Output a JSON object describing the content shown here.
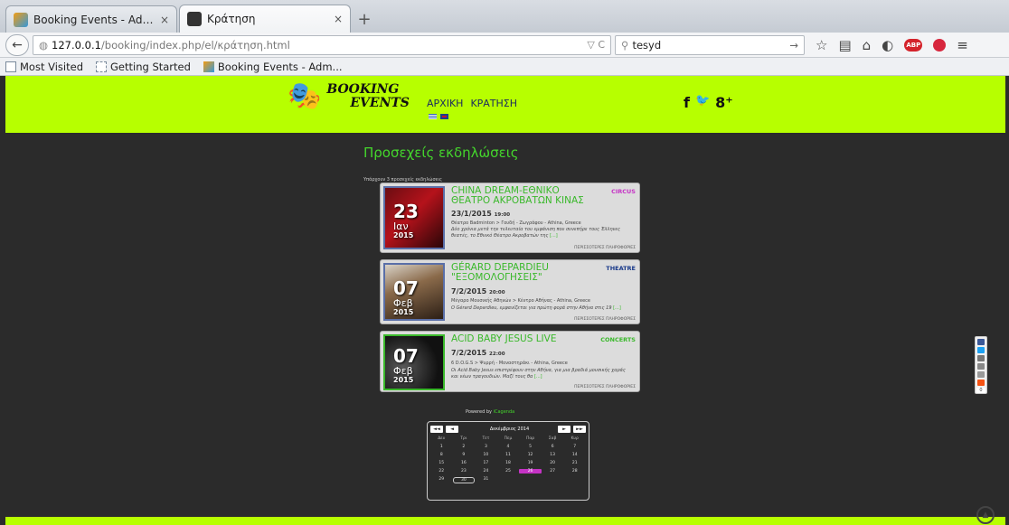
{
  "browser": {
    "tabs": [
      {
        "title": "Booking Events - Administ...",
        "close": "×",
        "active": false
      },
      {
        "title": "Κράτηση",
        "close": "×",
        "active": true
      }
    ],
    "new_tab": "+",
    "url_host": "127.0.0.1",
    "url_path": "/booking/index.php/el/κράτηση.html",
    "url_right": "▽ C",
    "search_value": "tesyd",
    "bookmarks": [
      "Most Visited",
      "Getting Started",
      "Booking Events - Adm..."
    ]
  },
  "site": {
    "logo": {
      "line1": "BOOKING",
      "line2": "EVENTS"
    },
    "menu": [
      "ΑΡΧΙΚΗ",
      "ΚΡΑΤΗΣΗ"
    ],
    "social": [
      "f",
      "🐦",
      "8⁺"
    ],
    "heading": "Προσεχείς εκδηλώσεις",
    "subheading": "Υπάρχουν 3 προσεχείς εκδηλώσεις",
    "events": [
      {
        "title": "CHINA DREAM-ΕΘΝΙΚΟ ΘΕΑΤΡΟ ΑΚΡΟΒΑΤΩΝ ΚΙΝΑΣ",
        "category": "CIRCUS",
        "category_color": "#c533c5",
        "day": "23",
        "month": "Ιαν",
        "year": "2015",
        "date": "23/1/2015",
        "time": "19:00",
        "venue": "Θέατρο Badminton > Γουδή - Ζωγράφου - Athina, Greece",
        "desc": "Δύο χρόνια μετά την τελευταία του εμφάνιση που συνεπήρε τους Έλληνες θεατές, το Εθνικό Θέατρο Ακροβατών της",
        "more": "[...]",
        "info": "ΠΕΡΙΣΣΟΤΕΡΕΣ ΠΛΗΡΟΦΟΡΙΕΣ"
      },
      {
        "title": "GÉRARD DEPARDIEU \"ΕΞΟΜΟΛΟΓΗΣΕΙΣ\"",
        "category": "THEATRE",
        "category_color": "#1a3a8a",
        "day": "07",
        "month": "Φεβ",
        "year": "2015",
        "date": "7/2/2015",
        "time": "20:00",
        "venue": "Μέγαρο Μουσικής Αθηνών > Κέντρο Αθήνας - Athina, Greece",
        "desc": "Ο Gérard Depardieu, εμφανίζεται για πρώτη φορά στην Αθήνα στις 19",
        "more": "[...]",
        "info": "ΠΕΡΙΣΣΟΤΕΡΕΣ ΠΛΗΡΟΦΟΡΙΕΣ"
      },
      {
        "title": "ACID BABY JESUS LIVE",
        "category": "CONCERTS",
        "category_color": "#39b82a",
        "day": "07",
        "month": "Φεβ",
        "year": "2015",
        "date": "7/2/2015",
        "time": "22:00",
        "venue": "6 D.O.G.S > Ψυρρή - Μοναστηράκι - Athina, Greece",
        "desc": "Οι Acid Baby Jesus επιστρέφουν στην Αθήνα, για μια βραδιά μουσικής χαράς και νέων τραγουδιών. Μαζί τους θα",
        "more": "[...]",
        "info": "ΠΕΡΙΣΣΟΤΕΡΕΣ ΠΛΗΡΟΦΟΡΙΕΣ"
      }
    ],
    "powered_by": "Powered by",
    "powered_link": "iCagenda",
    "calendar": {
      "prev_year": "◄◄",
      "prev_month": "◄",
      "month": "Δεκέμβριος 2014",
      "next_month": "►",
      "next_year": "►►",
      "weekdays": [
        "Δευ",
        "Τρι",
        "Τετ",
        "Πεμ",
        "Παρ",
        "Σαβ",
        "Κυρ"
      ],
      "days": [
        "1",
        "2",
        "3",
        "4",
        "5",
        "6",
        "7",
        "8",
        "9",
        "10",
        "11",
        "12",
        "13",
        "14",
        "15",
        "16",
        "17",
        "18",
        "19",
        "20",
        "21",
        "22",
        "23",
        "24",
        "25",
        "26",
        "27",
        "28",
        "29",
        "30",
        "31"
      ],
      "today": "26",
      "selected": "30"
    },
    "share_count": "0"
  }
}
